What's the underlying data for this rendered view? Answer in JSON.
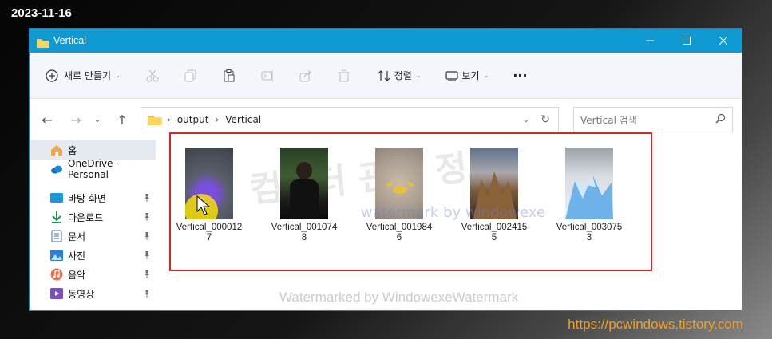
{
  "date_stamp": "2023-11-16",
  "site_url": "https://pcwindows.tistory.com",
  "window": {
    "title": "Vertical",
    "controls": [
      "minimize-icon",
      "maximize-icon",
      "close-icon"
    ]
  },
  "toolbar": {
    "new_label": "새로 만들기",
    "sort_label": "정렬",
    "view_label": "보기",
    "more_label": "···",
    "icons": [
      "cut-icon",
      "copy-icon",
      "paste-icon",
      "rename-icon",
      "share-icon",
      "delete-icon"
    ]
  },
  "address": {
    "crumbs": [
      "output",
      "Vertical"
    ],
    "search_placeholder": "Vertical 검색"
  },
  "sidebar": {
    "items": [
      {
        "label": "홈",
        "icon": "home-icon",
        "pinned": false
      },
      {
        "label": "OneDrive - Personal",
        "icon": "onedrive-icon",
        "pinned": false
      },
      {
        "label": "바탕 화면",
        "icon": "desktop-icon",
        "pinned": true
      },
      {
        "label": "다운로드",
        "icon": "download-icon",
        "pinned": true
      },
      {
        "label": "문서",
        "icon": "documents-icon",
        "pinned": true
      },
      {
        "label": "사진",
        "icon": "pictures-icon",
        "pinned": true
      },
      {
        "label": "음악",
        "icon": "music-icon",
        "pinned": true
      },
      {
        "label": "동영상",
        "icon": "videos-icon",
        "pinned": true
      }
    ]
  },
  "files": [
    {
      "name_line1": "Vertical_000012",
      "name_line2": "7"
    },
    {
      "name_line1": "Vertical_001074",
      "name_line2": "8"
    },
    {
      "name_line1": "Vertical_001984",
      "name_line2": "6"
    },
    {
      "name_line1": "Vertical_002415",
      "name_line2": "5"
    },
    {
      "name_line1": "Vertical_003075",
      "name_line2": "3"
    }
  ],
  "watermarks": {
    "big": "컴퓨터 관련 정보",
    "mid": "watermark by windowexe",
    "bottom": "Watermarked by WindowexeWatermark"
  },
  "colors": {
    "titlebar": "#109ad4",
    "selection_border": "#d52525",
    "url_text": "#f2a01e"
  }
}
